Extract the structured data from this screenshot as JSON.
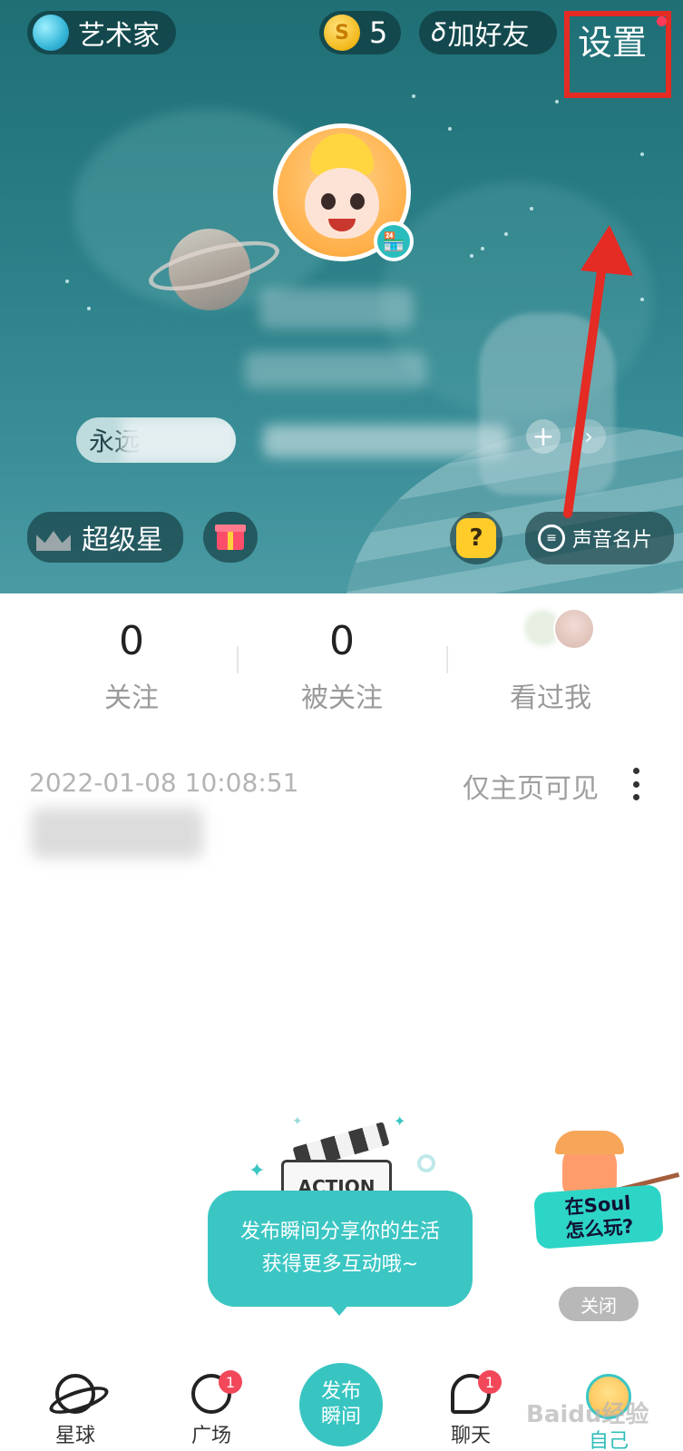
{
  "header": {
    "level_label": "艺术家",
    "coin_icon_glyph": "S",
    "coin_count": "5",
    "add_friend_label": "加好友",
    "settings_label": "设置",
    "tag_text": "永远",
    "super_star_label": "超级星",
    "voice_card_label": "声音名片",
    "mystery_glyph": "?",
    "plus_glyph": "+",
    "more_glyph": "›",
    "highlight_color": "#e42b24"
  },
  "stats": {
    "following_count": "0",
    "following_label": "关注",
    "followers_count": "0",
    "followers_label": "被关注",
    "visitors_label": "看过我"
  },
  "post": {
    "timestamp": "2022-01-08 10:08:51",
    "visibility": "仅主页可见"
  },
  "promo": {
    "clapper_text": "ACTION",
    "line1": "发布瞬间分享你的生活",
    "line2": "获得更多互动哦~",
    "guide_line1": "在Soul",
    "guide_line2": "怎么玩?",
    "close_label": "关闭"
  },
  "tabbar": {
    "planet_label": "星球",
    "square_label": "广场",
    "square_badge": "1",
    "publish_line1": "发布",
    "publish_line2": "瞬间",
    "chat_label": "聊天",
    "chat_badge": "1",
    "me_label": "自己",
    "accent_color": "#38c5c1"
  },
  "watermark": "Baidu经验"
}
